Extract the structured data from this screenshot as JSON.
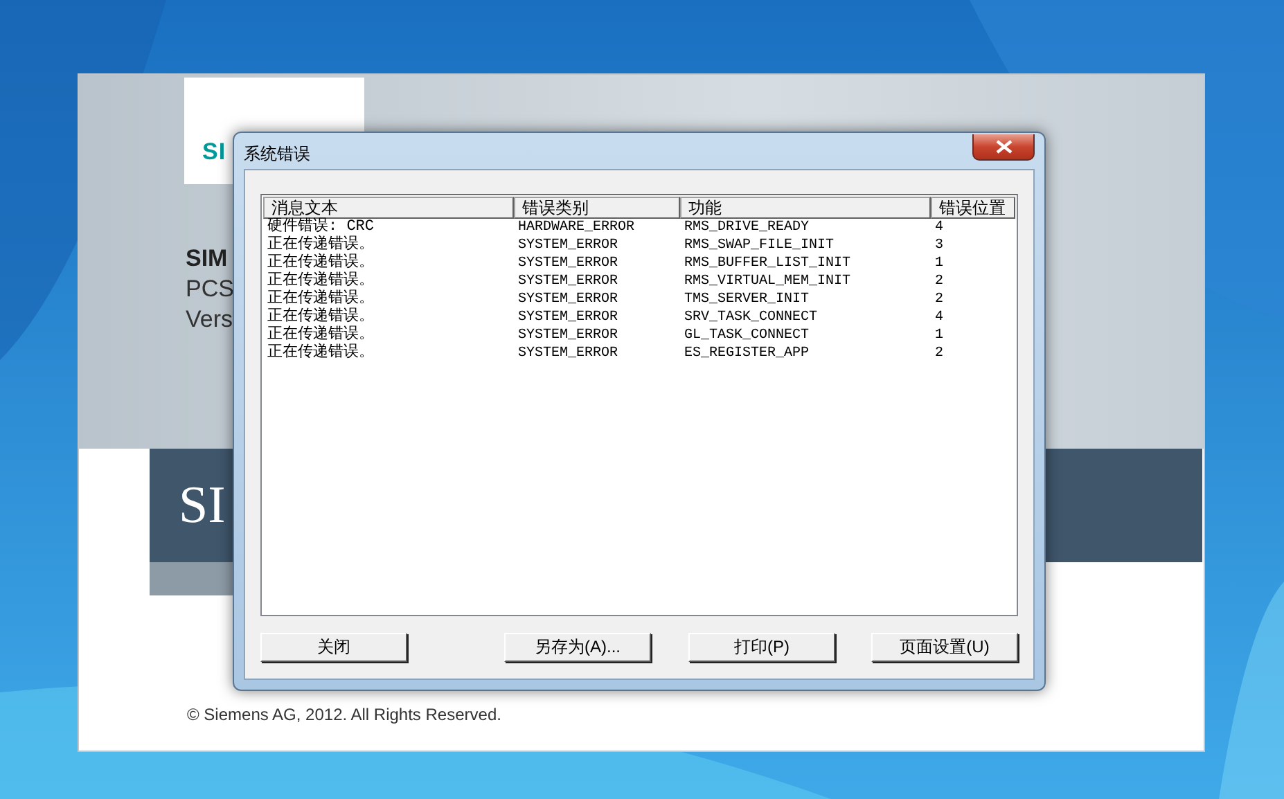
{
  "splash": {
    "logo": "SI",
    "product": "SIM",
    "line_2": "PCS",
    "line_3": "Vers",
    "banner": "SI",
    "copyright": "© Siemens AG, 2012. All Rights Reserved."
  },
  "dialog": {
    "title": "系统错误",
    "columns": [
      "消息文本",
      "错误类别",
      "功能",
      "错误位置"
    ],
    "rows": [
      [
        "硬件错误: CRC",
        "HARDWARE_ERROR",
        "RMS_DRIVE_READY",
        "4"
      ],
      [
        "正在传递错误。",
        "SYSTEM_ERROR",
        "RMS_SWAP_FILE_INIT",
        "3"
      ],
      [
        "正在传递错误。",
        "SYSTEM_ERROR",
        "RMS_BUFFER_LIST_INIT",
        "1"
      ],
      [
        "正在传递错误。",
        "SYSTEM_ERROR",
        "RMS_VIRTUAL_MEM_INIT",
        "2"
      ],
      [
        "正在传递错误。",
        "SYSTEM_ERROR",
        "TMS_SERVER_INIT",
        "2"
      ],
      [
        "正在传递错误。",
        "SYSTEM_ERROR",
        "SRV_TASK_CONNECT",
        "4"
      ],
      [
        "正在传递错误。",
        "SYSTEM_ERROR",
        "GL_TASK_CONNECT",
        "1"
      ],
      [
        "正在传递错误。",
        "SYSTEM_ERROR",
        "ES_REGISTER_APP",
        "2"
      ]
    ],
    "buttons": [
      "关闭",
      "另存为(A)...",
      "打印(P)",
      "页面设置(U)"
    ]
  }
}
